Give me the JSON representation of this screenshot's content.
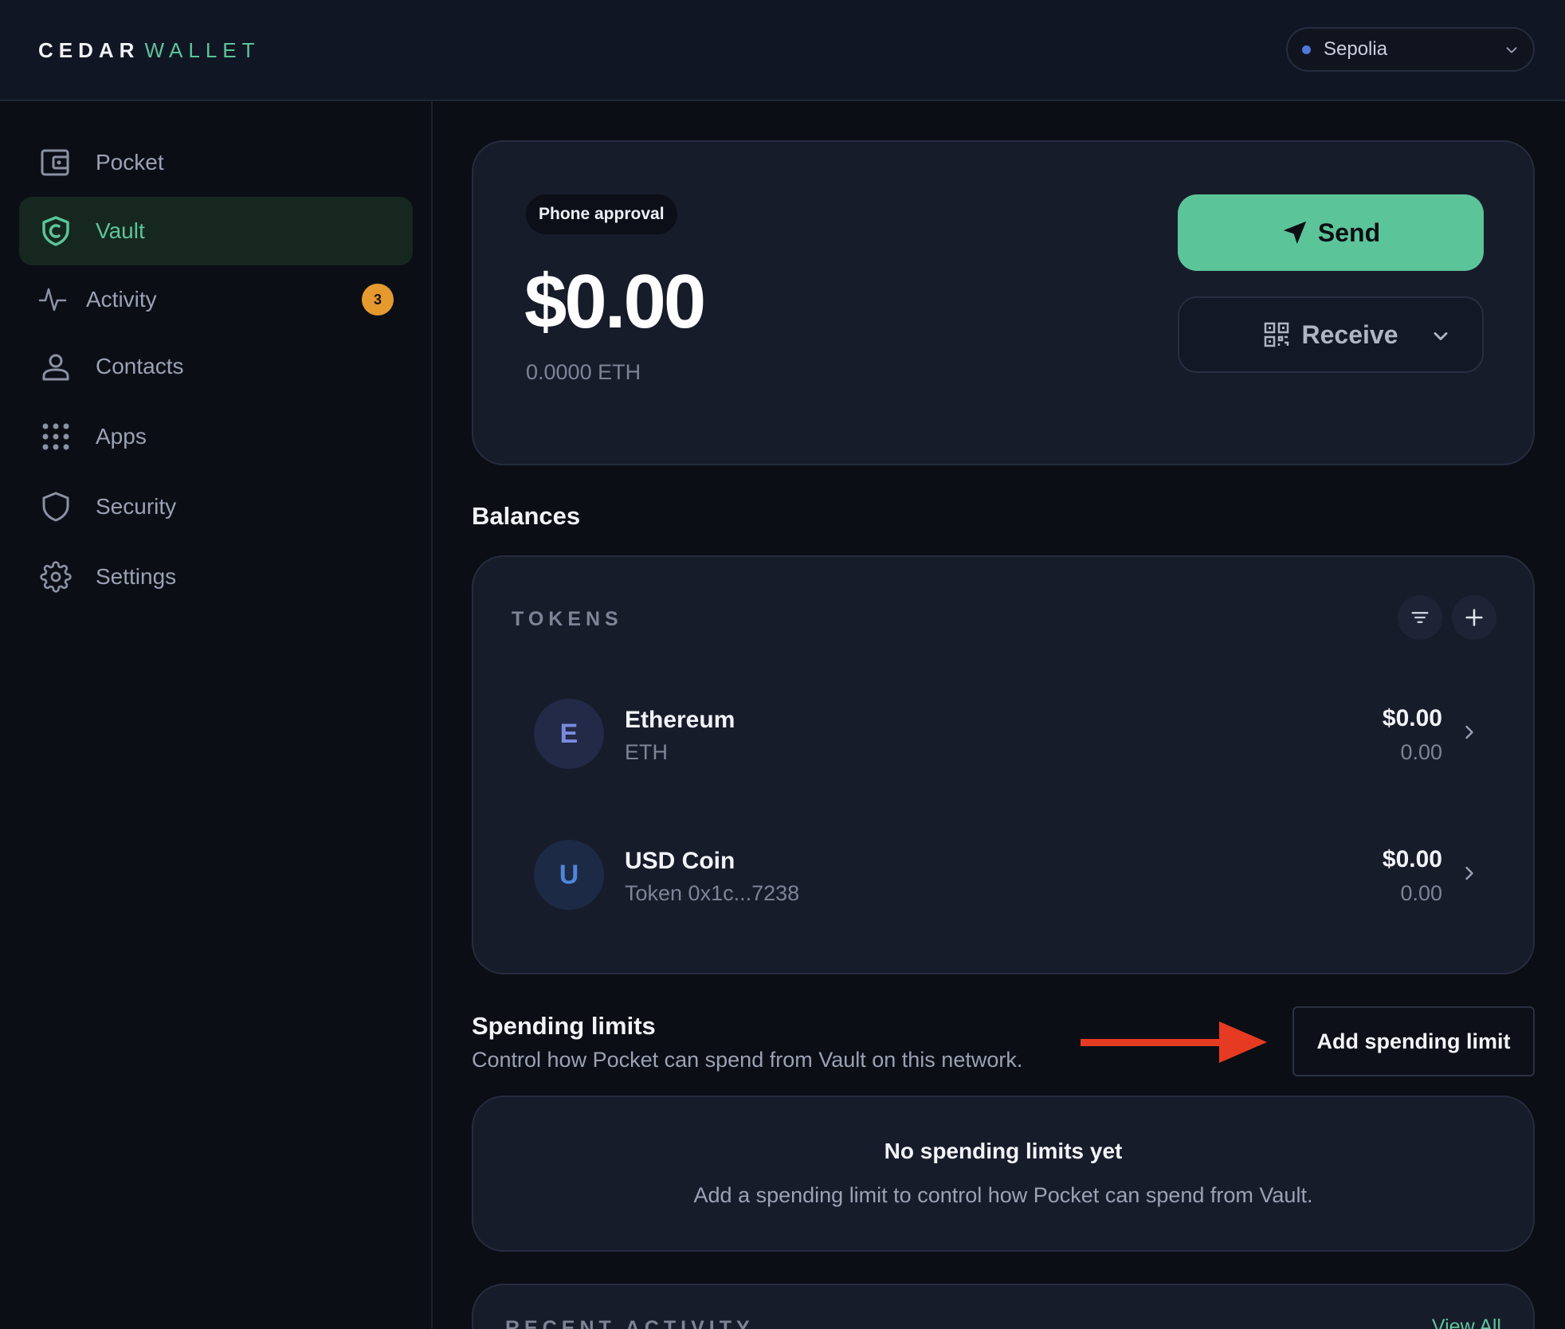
{
  "brand": {
    "part1": "CEDAR",
    "part2": "WALLET"
  },
  "network": {
    "label": "Sepolia"
  },
  "sidebar": {
    "items": [
      {
        "label": "Pocket",
        "icon": "wallet-icon"
      },
      {
        "label": "Vault",
        "icon": "shield-icon",
        "active": true
      },
      {
        "label": "Activity",
        "icon": "activity-icon",
        "badge": "3"
      },
      {
        "label": "Contacts",
        "icon": "user-icon"
      },
      {
        "label": "Apps",
        "icon": "grid-icon"
      },
      {
        "label": "Security",
        "icon": "shield-outline-icon"
      },
      {
        "label": "Settings",
        "icon": "gear-icon"
      }
    ]
  },
  "hero": {
    "pill": "Phone approval",
    "balance": "$0.00",
    "balance_sub": "0.0000 ETH",
    "send_label": "Send",
    "receive_label": "Receive"
  },
  "balances": {
    "title": "Balances",
    "tokens_label": "TOKENS",
    "tokens": [
      {
        "initial": "E",
        "name": "Ethereum",
        "symbol": "ETH",
        "usd": "$0.00",
        "amount": "0.00"
      },
      {
        "initial": "U",
        "name": "USD Coin",
        "symbol": "Token 0x1c...7238",
        "usd": "$0.00",
        "amount": "0.00"
      }
    ]
  },
  "spending": {
    "title": "Spending limits",
    "subtitle": "Control how Pocket can spend from Vault on this network.",
    "add_label": "Add spending limit",
    "empty_title": "No spending limits yet",
    "empty_sub": "Add a spending limit to control how Pocket can spend from Vault."
  },
  "recent": {
    "label": "RECENT ACTIVITY",
    "view_all": "View All"
  },
  "colors": {
    "accent": "#5cc499",
    "badge": "#e59a2f",
    "annotation_arrow": "#e63b22"
  }
}
